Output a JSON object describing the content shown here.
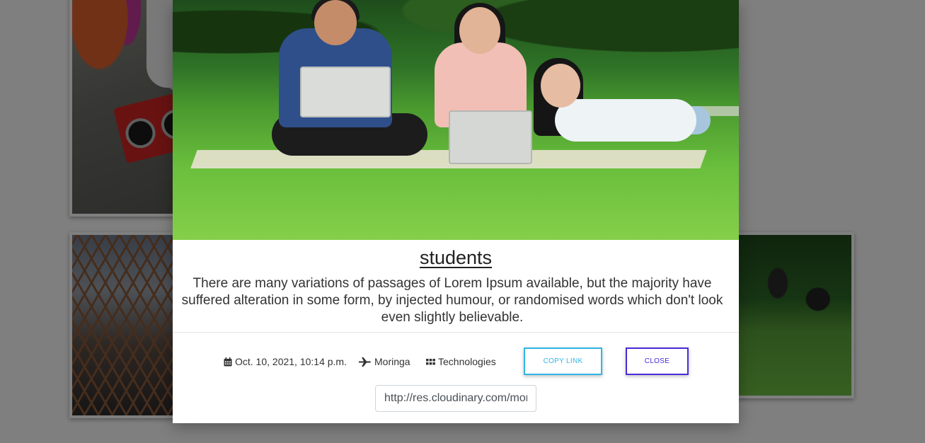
{
  "gallery": {
    "cards": [
      {
        "alt": "graffiti-radio-photo"
      },
      {
        "alt": "bridge-photo"
      },
      {
        "alt": "students-photo"
      }
    ]
  },
  "modal": {
    "title": "students",
    "description": "There are many variations of passages of Lorem Ipsum available, but the majority have suffered alteration in some form, by injected humour, or randomised words which don't look even slightly believable.",
    "meta": {
      "date": "Oct. 10, 2021, 10:14 p.m.",
      "author": "Moringa",
      "category": "Technologies",
      "date_icon": "calendar-icon",
      "author_icon": "plane-icon",
      "category_icon": "grid-icon"
    },
    "buttons": {
      "copy_link": "COPY LINK",
      "close": "CLOSE"
    },
    "link_value": "http://res.cloudinary.com/moringa",
    "colors": {
      "copy_button": "#33b5e5",
      "close_button": "#4a2ad8",
      "overlay": "rgba(0,0,0,0.5)"
    }
  }
}
